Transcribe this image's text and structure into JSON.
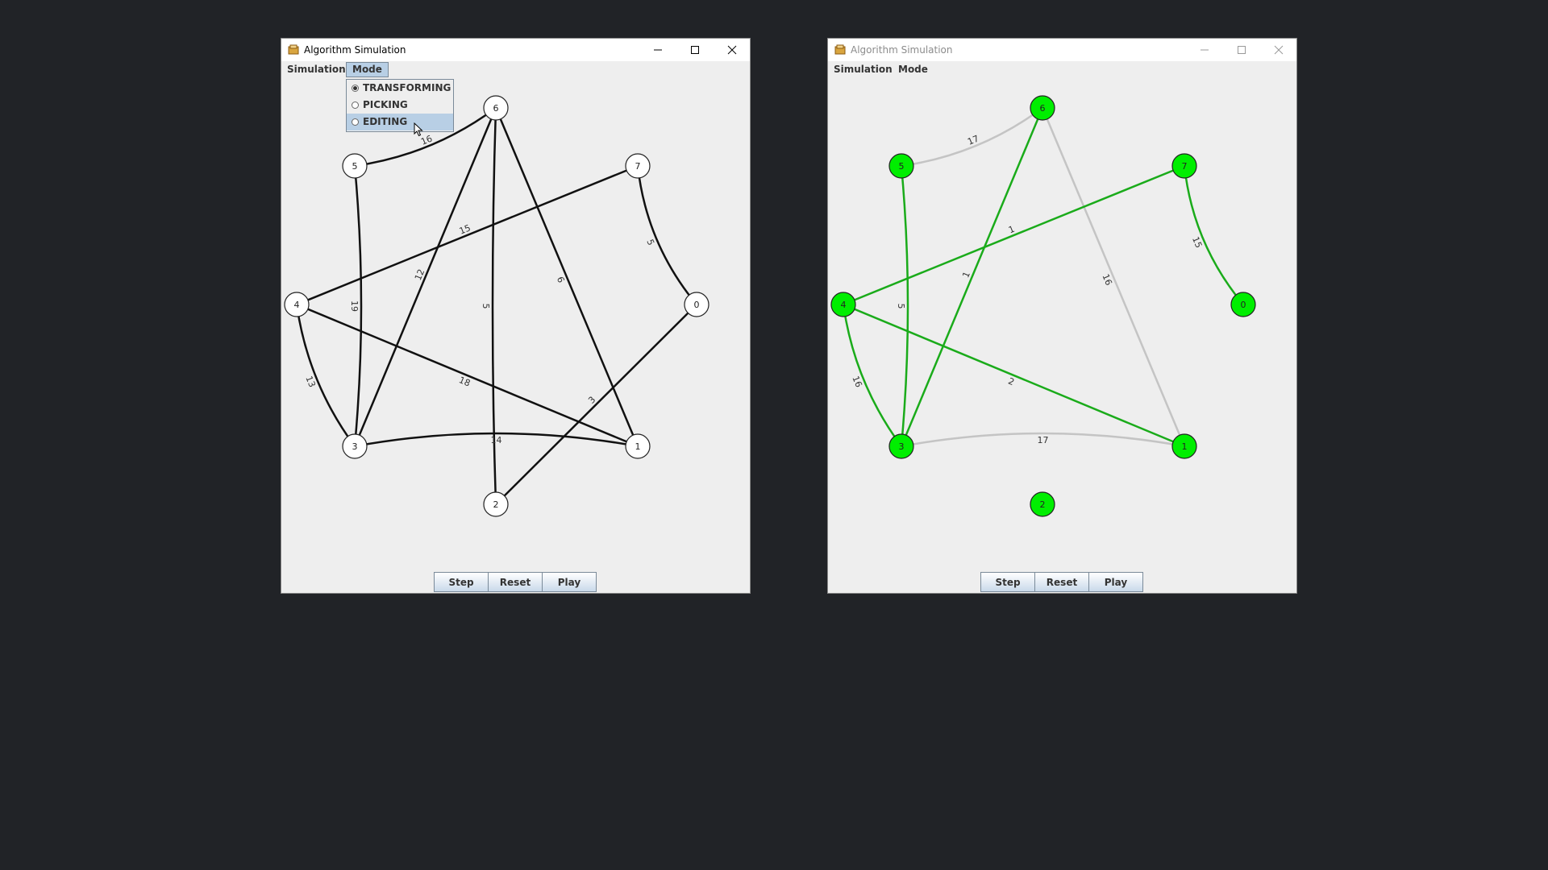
{
  "colors": {
    "desktop": "#212327",
    "window_bg": "#eeeeee",
    "edge_default": "#111111",
    "edge_tree": "#1aab1a",
    "edge_nontree": "#c4c4c4",
    "node_visited": "#00ee00"
  },
  "windows": [
    {
      "title": "Algorithm Simulation",
      "active": true,
      "menu": [
        "Simulation",
        "Mode"
      ],
      "open_menu": "Mode",
      "mode_menu": {
        "items": [
          {
            "label": "TRANSFORMING",
            "selected": true
          },
          {
            "label": "PICKING",
            "selected": false
          },
          {
            "label": "EDITING",
            "selected": false,
            "hover": true
          }
        ]
      },
      "buttons": [
        "Step",
        "Reset",
        "Play"
      ]
    },
    {
      "title": "Algorithm Simulation",
      "active": false,
      "menu": [
        "Simulation",
        "Mode"
      ],
      "buttons": [
        "Step",
        "Reset",
        "Play"
      ]
    }
  ],
  "graph_left": {
    "nodes": [
      "0",
      "1",
      "2",
      "3",
      "4",
      "5",
      "6",
      "7"
    ],
    "edges": [
      {
        "from": "6",
        "to": "5",
        "weight": "16",
        "color": "edge_default"
      },
      {
        "from": "5",
        "to": "3",
        "weight": "19",
        "color": "edge_default"
      },
      {
        "from": "6",
        "to": "3",
        "weight": "12",
        "color": "edge_default"
      },
      {
        "from": "6",
        "to": "2",
        "weight": "5",
        "color": "edge_default"
      },
      {
        "from": "6",
        "to": "1",
        "weight": "6",
        "color": "edge_default"
      },
      {
        "from": "7",
        "to": "4",
        "weight": "15",
        "color": "edge_default"
      },
      {
        "from": "7",
        "to": "0",
        "weight": "5",
        "color": "edge_default"
      },
      {
        "from": "4",
        "to": "3",
        "weight": "13",
        "color": "edge_default"
      },
      {
        "from": "4",
        "to": "1",
        "weight": "18",
        "color": "edge_default"
      },
      {
        "from": "3",
        "to": "1",
        "weight": "14",
        "color": "edge_default"
      },
      {
        "from": "0",
        "to": "2",
        "weight": "3",
        "color": "edge_default"
      }
    ]
  },
  "graph_right": {
    "nodes": [
      "0",
      "1",
      "2",
      "3",
      "4",
      "5",
      "6",
      "7"
    ],
    "edges": [
      {
        "from": "6",
        "to": "5",
        "weight": "17",
        "color": "edge_nontree"
      },
      {
        "from": "6",
        "to": "1",
        "weight": "16",
        "color": "edge_nontree"
      },
      {
        "from": "3",
        "to": "1",
        "weight": "17",
        "color": "edge_nontree"
      },
      {
        "from": "5",
        "to": "3",
        "weight": "5",
        "color": "edge_tree"
      },
      {
        "from": "6",
        "to": "3",
        "weight": "1",
        "color": "edge_tree"
      },
      {
        "from": "7",
        "to": "4",
        "weight": "1",
        "color": "edge_tree"
      },
      {
        "from": "7",
        "to": "0",
        "weight": "15",
        "color": "edge_tree"
      },
      {
        "from": "4",
        "to": "3",
        "weight": "16",
        "color": "edge_tree"
      },
      {
        "from": "4",
        "to": "1",
        "weight": "2",
        "color": "edge_tree"
      }
    ]
  }
}
